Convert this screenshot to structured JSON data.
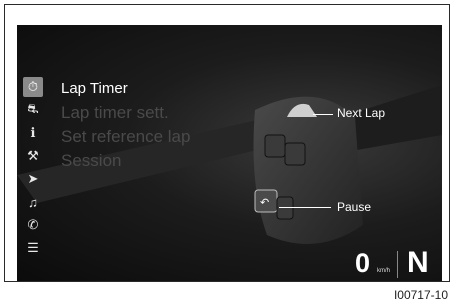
{
  "menu": {
    "items": [
      {
        "label": "Lap Timer",
        "active": true
      },
      {
        "label": "Lap timer sett.",
        "active": false
      },
      {
        "label": "Set reference lap",
        "active": false
      },
      {
        "label": "Session",
        "active": false
      }
    ]
  },
  "sidebar": {
    "icons": [
      {
        "name": "stopwatch-icon",
        "glyph": "⏱",
        "active": true
      },
      {
        "name": "motorcycle-icon",
        "glyph": "🏍",
        "active": false
      },
      {
        "name": "info-icon",
        "glyph": "ℹ",
        "active": false
      },
      {
        "name": "settings-wrench-icon",
        "glyph": "⚒",
        "active": false
      },
      {
        "name": "navigation-arrow-icon",
        "glyph": "➤",
        "active": false
      },
      {
        "name": "music-note-icon",
        "glyph": "♫",
        "active": false
      },
      {
        "name": "phone-icon",
        "glyph": "✆",
        "active": false
      },
      {
        "name": "sliders-icon",
        "glyph": "☰",
        "active": false
      }
    ]
  },
  "callouts": {
    "next_lap": "Next Lap",
    "pause": "Pause"
  },
  "status": {
    "speed": "0",
    "speed_unit": "km/h",
    "gear": "N"
  },
  "figure_ref": "I00717-10"
}
